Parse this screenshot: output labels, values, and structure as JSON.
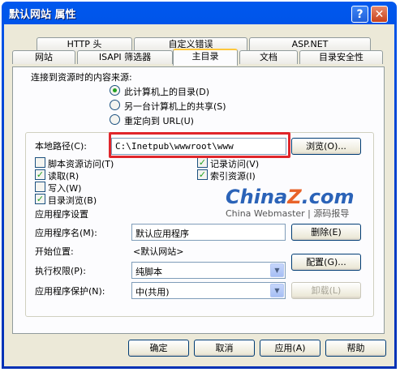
{
  "window": {
    "title": "默认网站 属性",
    "help_glyph": "?",
    "close_glyph": "✕"
  },
  "tabs_row1": [
    "HTTP 头",
    "自定义错误",
    "ASP.NET"
  ],
  "tabs_row2": [
    "网站",
    "ISAPI 筛选器",
    "主目录",
    "文档",
    "目录安全性"
  ],
  "active_tab": "主目录",
  "source": {
    "heading": "连接到资源时的内容来源:",
    "options": [
      {
        "label": "此计算机上的目录(D)",
        "selected": true
      },
      {
        "label": "另一台计算机上的共享(S)",
        "selected": false
      },
      {
        "label": "重定向到 URL(U)",
        "selected": false
      }
    ]
  },
  "local_path": {
    "label": "本地路径(C):",
    "value": "C:\\Inetpub\\wwwroot\\www",
    "browse_button": "浏览(O)..."
  },
  "permissions_left": [
    {
      "label": "脚本资源访问(T)",
      "checked": false
    },
    {
      "label": "读取(R)",
      "checked": true
    },
    {
      "label": "写入(W)",
      "checked": false
    },
    {
      "label": "目录浏览(B)",
      "checked": true
    }
  ],
  "permissions_right": [
    {
      "label": "记录访问(V)",
      "checked": true
    },
    {
      "label": "索引资源(I)",
      "checked": true
    }
  ],
  "watermark": {
    "logo_a": "China",
    "logo_z": "Z",
    "logo_b": ".com",
    "sub": "China Webmaster | 源码报导"
  },
  "app_settings": {
    "heading": "应用程序设置",
    "name_label": "应用程序名(M):",
    "name_value": "默认应用程序",
    "remove_button": "删除(E)",
    "start_label": "开始位置:",
    "start_value": "<默认网站>",
    "config_button": "配置(G)...",
    "exec_label": "执行权限(P):",
    "exec_value": "纯脚本",
    "protect_label": "应用程序保护(N):",
    "protect_value": "中(共用)",
    "unload_button": "卸载(L)"
  },
  "footer": {
    "ok": "确定",
    "cancel": "取消",
    "apply": "应用(A)",
    "help": "帮助"
  },
  "colors": {
    "highlight_box": "#e0262b",
    "title_bar": "#0058ee",
    "active_tab_accent": "#ffc83c"
  }
}
